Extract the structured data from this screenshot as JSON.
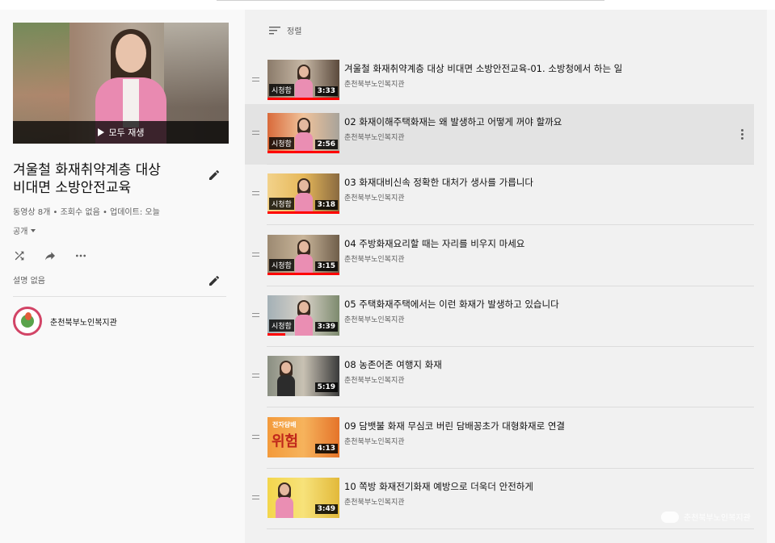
{
  "playlist": {
    "title_line1": "겨울철 화재취약계층 대상",
    "title_line2": "비대면 소방안전교육",
    "stats": "동영상 8개 • 조회수 없음 • 업데이트: 오늘",
    "privacy": "공개",
    "play_all": "모두 재생",
    "description": "설명 없음",
    "owner": "춘천북부노인복지관"
  },
  "list": {
    "sort_label": "정렬",
    "videos": [
      {
        "title": "겨울철 화재취약계층 대상 비대면 소방안전교육-01. 소방청에서 하는 일",
        "channel": "춘천북부노인복지관",
        "duration": "3:33",
        "watched": "시청함",
        "watched_fraction": 1.0,
        "colors": [
          "#8b7b6a",
          "#c7b8a6",
          "#5b4a3c"
        ]
      },
      {
        "title": "02 화재이해주택화재는 왜 발생하고 어떻게 꺼야 할까요",
        "channel": "춘천북부노인복지관",
        "duration": "2:56",
        "watched": "시청함",
        "watched_fraction": 1.0,
        "colors": [
          "#d96a3a",
          "#f0c39b",
          "#a8a39a"
        ]
      },
      {
        "title": "03 화재대비신속 정확한 대처가 생사를 가릅니다",
        "channel": "춘천북부노인복지관",
        "duration": "3:18",
        "watched": "시청함",
        "watched_fraction": 1.0,
        "colors": [
          "#f2d28a",
          "#e6b85a",
          "#8a6a40"
        ]
      },
      {
        "title": "04 주방화재요리할 때는 자리를 비우지 마세요",
        "channel": "춘천북부노인복지관",
        "duration": "3:15",
        "watched": "시청함",
        "watched_fraction": 1.0,
        "colors": [
          "#9c8a72",
          "#c9b59a",
          "#6f5e4a"
        ]
      },
      {
        "title": "05 주택화재주택에서는 이런 화재가 발생하고 있습니다",
        "channel": "춘천북부노인복지관",
        "duration": "3:39",
        "watched": "시청함",
        "watched_fraction": 0.25,
        "colors": [
          "#a3b0b6",
          "#d8d2c8",
          "#7d8a6e"
        ]
      },
      {
        "title": "08 농존어존 여행지 화재",
        "channel": "춘천북부노인복지관",
        "duration": "5:19",
        "watched": "",
        "watched_fraction": 0.0,
        "colors": [
          "#8a8f82",
          "#c8c1b3",
          "#3a3a3a"
        ]
      },
      {
        "title": "09 담뱃불 화재 무심코 버린 담배꽁초가 대형화재로 연결",
        "channel": "춘천북부노인복지관",
        "duration": "4:13",
        "watched": "",
        "watched_fraction": 0.0,
        "colors": [
          "#f39a3b",
          "#f6b35c",
          "#e5742a"
        ],
        "thumb_text_1": "전자담배",
        "thumb_text_2": "위험"
      },
      {
        "title": "10 쪽방 화재전기화재 예방으로 더욱더 안전하게",
        "channel": "춘천북부노인복지관",
        "duration": "3:49",
        "watched": "",
        "watched_fraction": 0.0,
        "colors": [
          "#f3d64c",
          "#f7e27a",
          "#e2b93a"
        ]
      }
    ]
  },
  "watermark": "춘천북부노인복지관"
}
